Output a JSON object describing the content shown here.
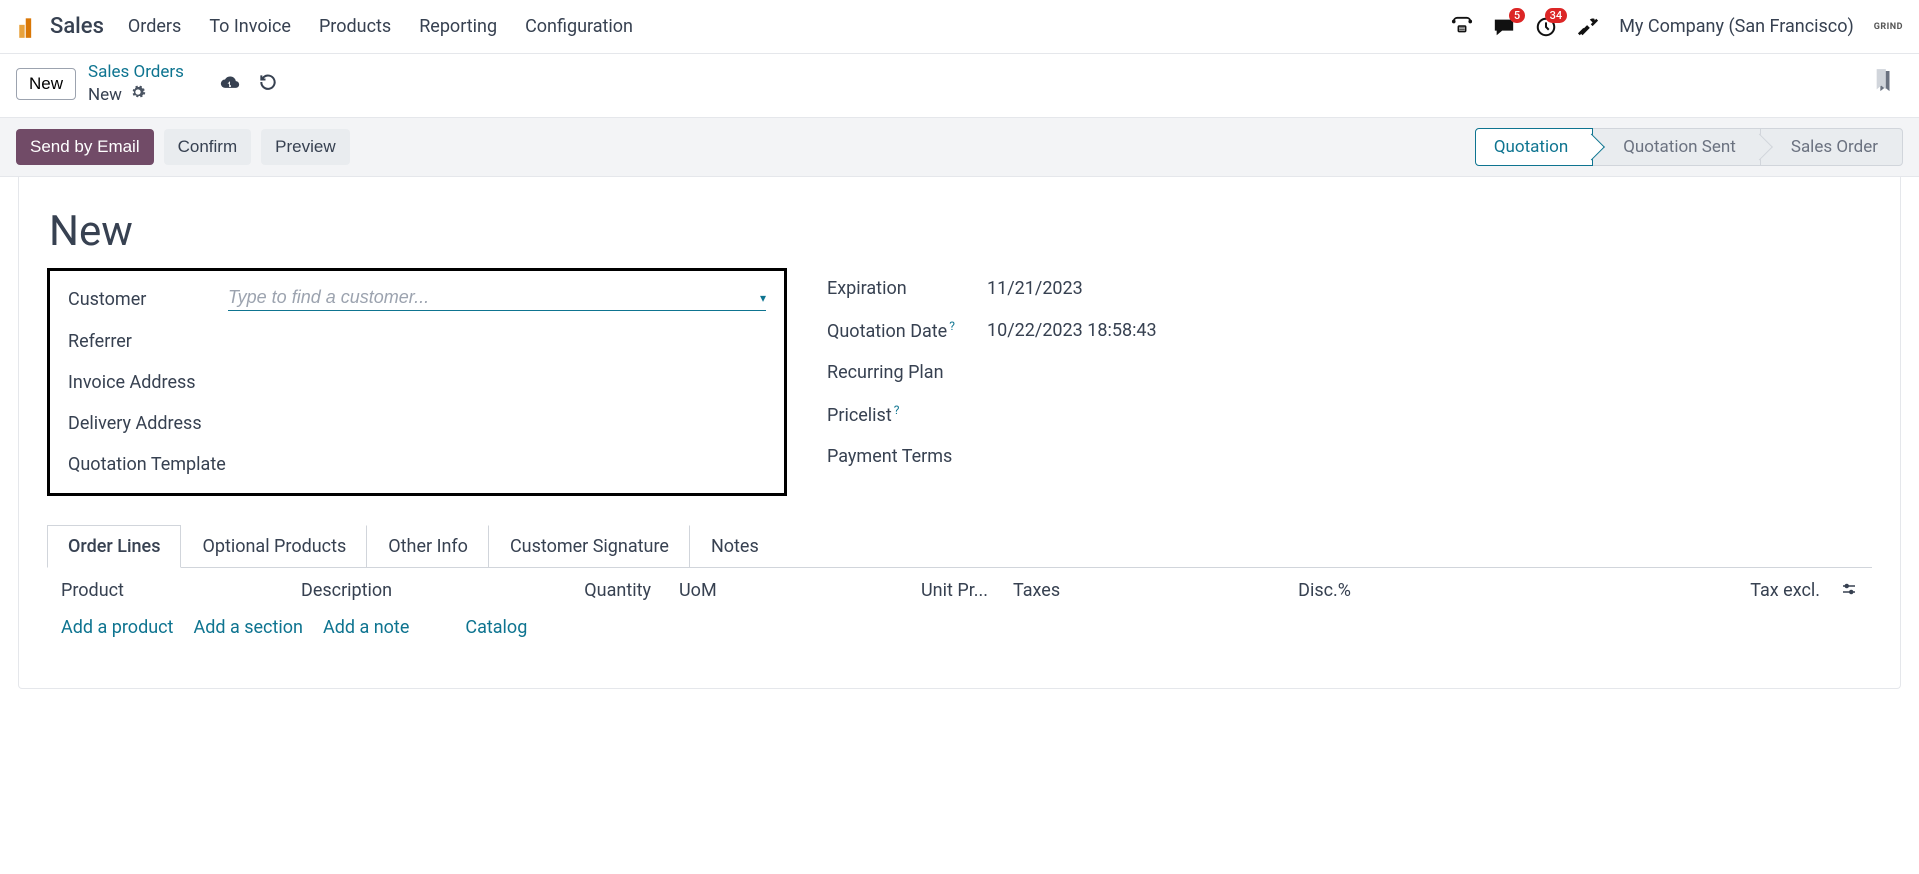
{
  "app": {
    "title": "Sales",
    "nav": [
      "Orders",
      "To Invoice",
      "Products",
      "Reporting",
      "Configuration"
    ],
    "company": "My Company (San Francisco)",
    "brand": "GRIND",
    "badge_messages": "5",
    "badge_activities": "34"
  },
  "breadcrumb": {
    "new_btn": "New",
    "parent": "Sales Orders",
    "current": "New"
  },
  "actions": {
    "send": "Send by Email",
    "confirm": "Confirm",
    "preview": "Preview"
  },
  "stages": [
    "Quotation",
    "Quotation Sent",
    "Sales Order"
  ],
  "form": {
    "title": "New",
    "left_labels": {
      "customer": "Customer",
      "referrer": "Referrer",
      "invoice_address": "Invoice Address",
      "delivery_address": "Delivery Address",
      "quotation_template": "Quotation Template"
    },
    "customer_placeholder": "Type to find a customer...",
    "right": {
      "expiration": {
        "label": "Expiration",
        "value": "11/21/2023"
      },
      "quotation_date": {
        "label": "Quotation Date",
        "value": "10/22/2023 18:58:43"
      },
      "recurring_plan": {
        "label": "Recurring Plan",
        "value": ""
      },
      "pricelist": {
        "label": "Pricelist",
        "value": ""
      },
      "payment_terms": {
        "label": "Payment Terms",
        "value": ""
      }
    }
  },
  "tabs": [
    "Order Lines",
    "Optional Products",
    "Other Info",
    "Customer Signature",
    "Notes"
  ],
  "table": {
    "cols": {
      "product": "Product",
      "description": "Description",
      "quantity": "Quantity",
      "uom": "UoM",
      "unit_price": "Unit Pr...",
      "taxes": "Taxes",
      "disc": "Disc.%",
      "tax_excl": "Tax excl."
    },
    "links": {
      "add_product": "Add a product",
      "add_section": "Add a section",
      "add_note": "Add a note",
      "catalog": "Catalog"
    }
  }
}
